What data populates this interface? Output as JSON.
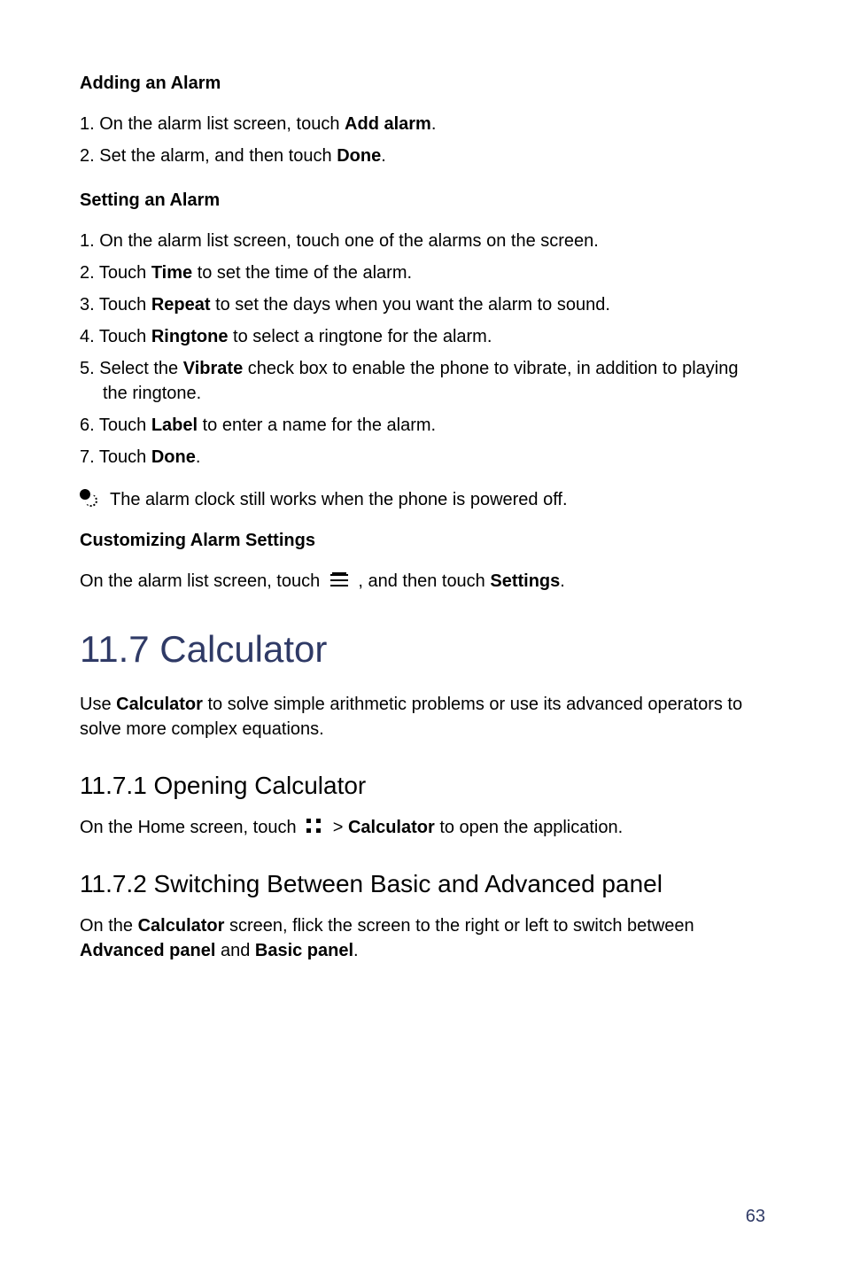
{
  "sections": {
    "adding_alarm": {
      "heading": "Adding an Alarm",
      "steps": [
        {
          "pre": "1. On the alarm list screen, touch ",
          "bold": "Add alarm",
          "post": "."
        },
        {
          "pre": "2. Set the alarm, and then touch ",
          "bold": "Done",
          "post": "."
        }
      ]
    },
    "setting_alarm": {
      "heading": "Setting an Alarm",
      "steps": [
        {
          "pre": "1. On the alarm list screen, touch one of the alarms on the screen."
        },
        {
          "pre": "2. Touch ",
          "bold": "Time",
          "post": " to set the time of the alarm."
        },
        {
          "pre": "3. Touch ",
          "bold": "Repeat",
          "post": " to set the days when you want the alarm to sound."
        },
        {
          "pre": "4. Touch ",
          "bold": "Ringtone",
          "post": " to select a ringtone for the alarm."
        },
        {
          "pre": "5. Select the ",
          "bold": "Vibrate",
          "post": " check box to enable the phone to vibrate, in addition to playing the ringtone."
        },
        {
          "pre": "6. Touch ",
          "bold": "Label",
          "post": " to enter a name for the alarm."
        },
        {
          "pre": "7. Touch ",
          "bold": "Done",
          "post": "."
        }
      ],
      "note": "The alarm clock still works when the phone is powered off."
    },
    "customizing": {
      "heading": "Customizing Alarm Settings",
      "para_pre": "On the alarm list screen, touch ",
      "para_mid": " , and then touch ",
      "para_bold": "Settings",
      "para_post": "."
    }
  },
  "calculator": {
    "title": "11.7  Calculator",
    "intro_pre": "Use ",
    "intro_bold": "Calculator",
    "intro_post": " to solve simple arithmetic problems or use its advanced operators to solve more complex equations.",
    "opening": {
      "heading": "11.7.1  Opening Calculator",
      "para_pre": "On the Home screen, touch ",
      "para_mid": "  > ",
      "para_bold": "Calculator",
      "para_post": " to open the application."
    },
    "switching": {
      "heading": "11.7.2  Switching Between Basic and Advanced panel",
      "line1_pre": "On the ",
      "line1_bold": "Calculator",
      "line1_post": " screen, flick the screen to the right or left to switch between ",
      "line2_bold1": "Advanced panel",
      "line2_mid": " and ",
      "line2_bold2": "Basic panel",
      "line2_post": "."
    }
  },
  "page_number": "63"
}
